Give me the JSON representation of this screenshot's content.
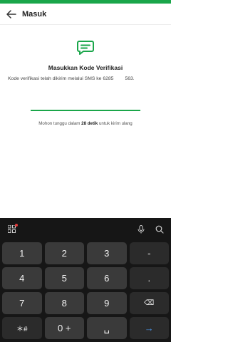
{
  "header": {
    "title": "Masuk",
    "back_icon": "arrow-left-icon"
  },
  "verification": {
    "icon": "chat-bubble-icon",
    "accent": "#1aa64a",
    "title": "Masukkan Kode Verifikasi",
    "description_prefix": "Kode verifikasi telah dikirim melalui SMS ke 6285",
    "description_suffix": "563.",
    "countdown_prefix": "Mohon tunggu dalam",
    "countdown_value": "28 detik",
    "countdown_suffix": "untuk kirim ulang"
  },
  "keyboard": {
    "toolbar": {
      "grid_icon": "grid-icon",
      "mic_icon": "mic-icon",
      "search_icon": "search-icon"
    },
    "keys": {
      "k1": "1",
      "k2": "2",
      "k3": "3",
      "minus": "-",
      "k4": "4",
      "k5": "5",
      "k6": "6",
      "dot": ".",
      "k7": "7",
      "k8": "8",
      "k9": "9",
      "backspace": "⌫",
      "star_hash": "＊#",
      "zero_plus": "0 +",
      "space": "␣",
      "enter": "→"
    }
  }
}
